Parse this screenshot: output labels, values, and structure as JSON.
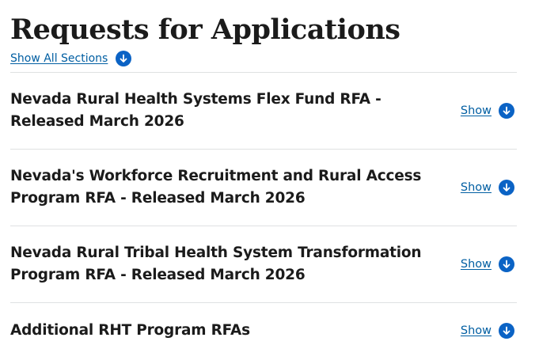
{
  "page": {
    "title": "Requests for Applications",
    "show_all_label": "Show All Sections"
  },
  "sections": [
    {
      "title": "Nevada Rural Health Systems Flex Fund RFA - Released March 2026",
      "toggle_label": "Show",
      "expanded": false
    },
    {
      "title": "Nevada's Workforce Recruitment and Rural Access Program RFA - Released March 2026",
      "toggle_label": "Show",
      "expanded": false
    },
    {
      "title": "Nevada Rural Tribal Health System Transformation Program RFA - Released March 2026",
      "toggle_label": "Show",
      "expanded": false
    },
    {
      "title": "Additional RHT Program RFAs",
      "toggle_label": "Show",
      "expanded": false
    }
  ],
  "icons": {
    "toggle_icon": "chevron-down-circle-icon",
    "accent_color": "#0b63c5",
    "link_color": "#005ea2"
  }
}
